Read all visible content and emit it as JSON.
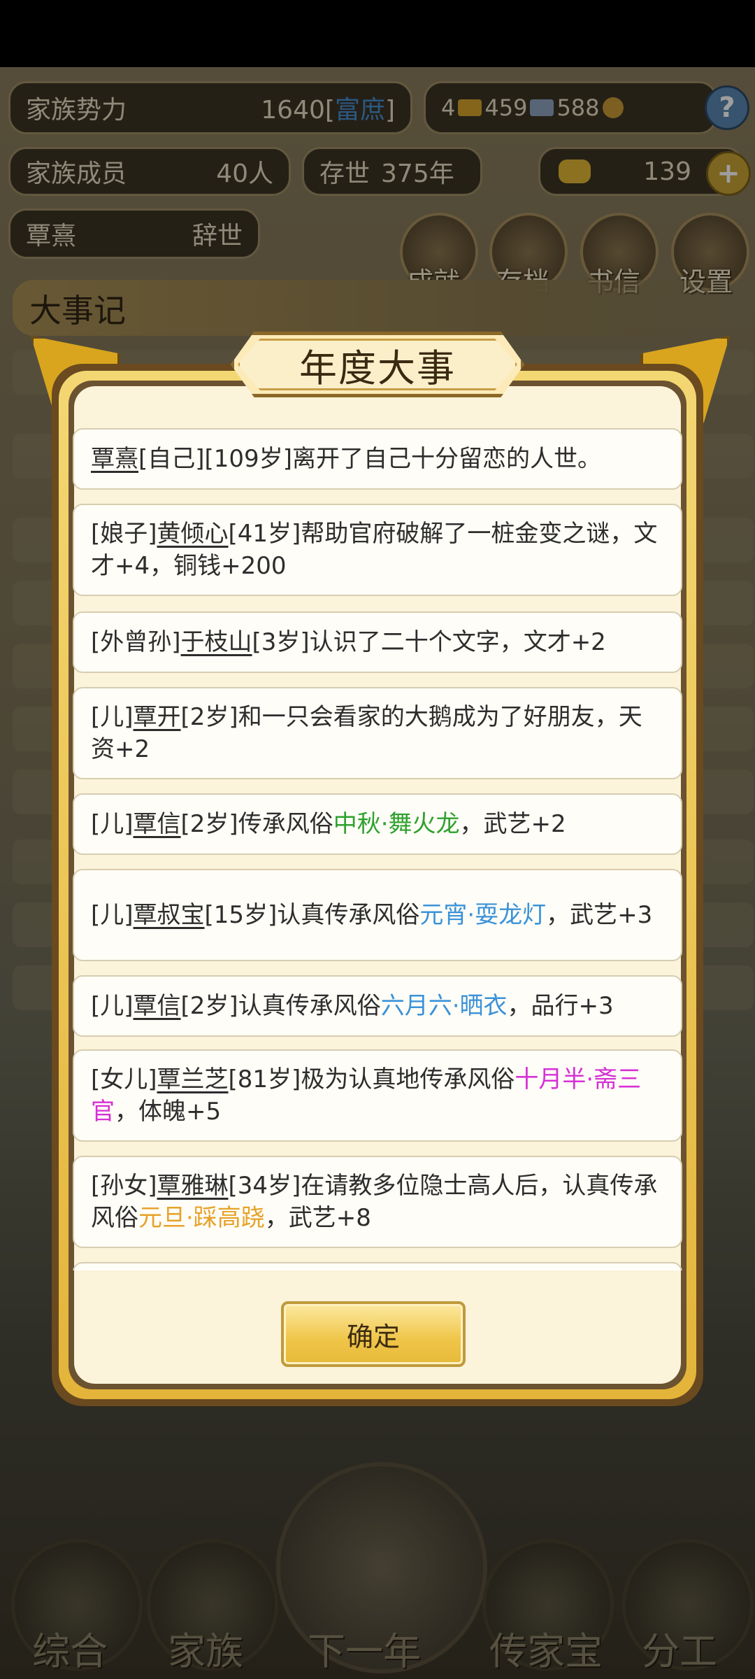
{
  "hud": {
    "clan_power_label": "家族势力",
    "clan_power_value": "1640",
    "clan_power_rank_open": "[",
    "clan_power_rank": "富庶",
    "clan_power_rank_close": "]",
    "gold_count": "4",
    "silver_count": "459",
    "coin_count": "588",
    "help_icon": "?",
    "members_label": "家族成员",
    "members_value": "40人",
    "existence_label": "存世",
    "existence_value": "375年",
    "ingot_count": "139",
    "add_icon": "+",
    "leader_name": "覃熹",
    "leader_status": "辞世"
  },
  "top_buttons": [
    "成就",
    "存档",
    "书信",
    "设置"
  ],
  "events_heading": "大事记",
  "bottom_nav": [
    "综合",
    "家族",
    "下一年",
    "传家宝",
    "分工"
  ],
  "modal": {
    "title": "年度大事",
    "confirm_label": "确定",
    "entries": [
      {
        "segs": [
          {
            "t": "覃熹",
            "k": "name"
          },
          {
            "t": "[自己][109岁]离开了自己十分留恋的人世。"
          }
        ]
      },
      {
        "segs": [
          {
            "t": "[娘子]"
          },
          {
            "t": "黄倾心",
            "k": "name"
          },
          {
            "t": "[41岁]帮助官府破解了一桩金变之谜，文才+4，铜钱+200"
          }
        ]
      },
      {
        "segs": [
          {
            "t": "[外曾孙]"
          },
          {
            "t": "于枝山",
            "k": "name"
          },
          {
            "t": "[3岁]认识了二十个文字，文才+2"
          }
        ]
      },
      {
        "segs": [
          {
            "t": "[儿]"
          },
          {
            "t": "覃开",
            "k": "name"
          },
          {
            "t": "[2岁]和一只会看家的大鹅成为了好朋友，天资+2"
          }
        ]
      },
      {
        "segs": [
          {
            "t": "[儿]"
          },
          {
            "t": "覃信",
            "k": "name"
          },
          {
            "t": "[2岁]传承风俗"
          },
          {
            "t": "中秋·舞火龙",
            "k": "green"
          },
          {
            "t": "，武艺+2"
          }
        ]
      },
      {
        "segs": [
          {
            "t": "[儿]"
          },
          {
            "t": "覃叔宝",
            "k": "name"
          },
          {
            "t": "[15岁]认真传承风俗"
          },
          {
            "t": "元宵·耍龙灯",
            "k": "blue"
          },
          {
            "t": "，武艺+3"
          }
        ]
      },
      {
        "segs": [
          {
            "t": "[儿]"
          },
          {
            "t": "覃信",
            "k": "name"
          },
          {
            "t": "[2岁]认真传承风俗"
          },
          {
            "t": "六月六·晒衣",
            "k": "blue"
          },
          {
            "t": "，品行+3"
          }
        ]
      },
      {
        "segs": [
          {
            "t": "[女儿]"
          },
          {
            "t": "覃兰芝",
            "k": "name"
          },
          {
            "t": "[81岁]极为认真地传承风俗"
          },
          {
            "t": "十月半·斋三官",
            "k": "magenta"
          },
          {
            "t": "，体魄+5"
          }
        ]
      },
      {
        "segs": [
          {
            "t": "[孙女]"
          },
          {
            "t": "覃雅琳",
            "k": "name"
          },
          {
            "t": "[34岁]在请教多位隐士高人后，认真传承风俗"
          },
          {
            "t": "元旦·踩高跷",
            "k": "orange"
          },
          {
            "t": "，武艺+8"
          }
        ]
      }
    ]
  }
}
